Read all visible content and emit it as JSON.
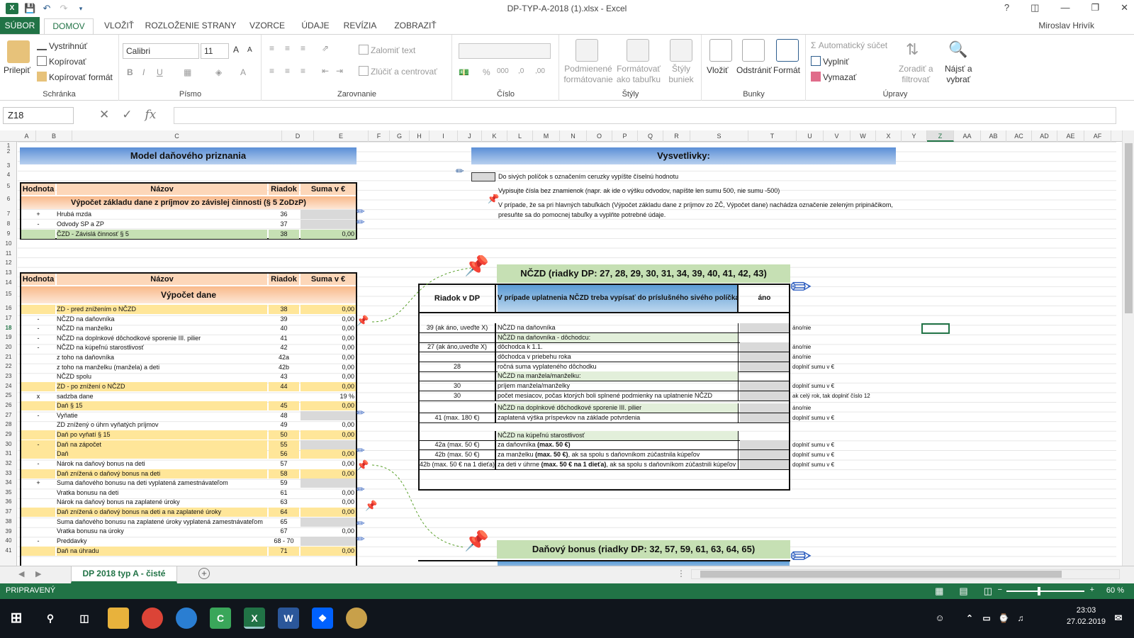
{
  "window": {
    "title": "DP-TYP-A-2018 (1).xlsx - Excel",
    "help": "?",
    "minimize": "—",
    "restore": "❐",
    "close": "✕"
  },
  "menu": {
    "file": "SÚBOR",
    "tabs": [
      "DOMOV",
      "VLOŽIŤ",
      "ROZLOŽENIE STRANY",
      "VZORCE",
      "ÚDAJE",
      "REVÍZIA",
      "ZOBRAZIŤ"
    ],
    "user": "Miroslav Hrivík"
  },
  "ribbon": {
    "clipboard": {
      "paste": "Prilepiť",
      "cut": "Vystrihnúť",
      "copy": "Kopírovať",
      "format_painter": "Kopírovať formát",
      "label": "Schránka"
    },
    "font": {
      "name": "Calibri",
      "size": "11",
      "label": "Písmo"
    },
    "alignment": {
      "wrap": "Zalomiť text",
      "merge": "Zlúčiť a centrovať",
      "label": "Zarovnanie"
    },
    "number": {
      "format": "",
      "label": "Číslo"
    },
    "styles": {
      "conditional_1": "Podmienené",
      "conditional_2": "formátovanie",
      "table_1": "Formátovať",
      "table_2": "ako tabuľku",
      "cell_1": "Štýly",
      "cell_2": "buniek",
      "label": "Štýly"
    },
    "cells": {
      "insert": "Vložiť",
      "delete": "Odstrániť",
      "format": "Formát",
      "label": "Bunky"
    },
    "editing": {
      "autosum": "Automatický súčet",
      "fill": "Vyplniť",
      "clear": "Vymazať",
      "sort_1": "Zoradiť a",
      "sort_2": "filtrovať",
      "find_1": "Nájsť a",
      "find_2": "vybrať",
      "label": "Úpravy"
    }
  },
  "formula_bar": {
    "name_box": "Z18",
    "fx": "fx",
    "formula": ""
  },
  "columns": [
    "A",
    "B",
    "C",
    "D",
    "E",
    "F",
    "G",
    "H",
    "I",
    "J",
    "K",
    "L",
    "M",
    "N",
    "O",
    "P",
    "Q",
    "R",
    "S",
    "T",
    "U",
    "V",
    "W",
    "X",
    "Y",
    "Z",
    "AA",
    "AB",
    "AC",
    "AD",
    "AE",
    "AF"
  ],
  "rows": [
    "1",
    "2",
    "3",
    "4",
    "5",
    "6",
    "7",
    "8",
    "9",
    "10",
    "11",
    "12",
    "13",
    "14",
    "15",
    "16",
    "17",
    "18",
    "19",
    "20",
    "21",
    "22",
    "23",
    "24",
    "25",
    "26",
    "27",
    "28",
    "29",
    "30",
    "31",
    "32",
    "33",
    "34",
    "35",
    "36",
    "37",
    "38",
    "39",
    "40",
    "41"
  ],
  "sheet": {
    "model_title": "Model daňového priznania",
    "table1": {
      "headers": [
        "Hodnota",
        "Názov",
        "Riadok",
        "Suma v €"
      ],
      "section": "Výpočet základu dane z príjmov zo závislej činnosti (§ 5 ZoDzP)",
      "rows": [
        {
          "op": "+",
          "name": "Hrubá mzda",
          "line": "36",
          "sum": ""
        },
        {
          "op": "-",
          "name": "Odvody SP a ZP",
          "line": "37",
          "sum": ""
        },
        {
          "op": "",
          "name": "ČZD - Závislá činnosť § 5",
          "line": "38",
          "sum": "0,00"
        }
      ]
    },
    "table2": {
      "headers": [
        "Hodnota",
        "Názov",
        "Riadok",
        "Suma v €"
      ],
      "section": "Výpočet dane",
      "rows": [
        {
          "op": "",
          "name": "ZD - pred znížením o NČZD",
          "line": "38",
          "sum": "0,00"
        },
        {
          "op": "-",
          "name": "NČZD na daňovníka",
          "line": "39",
          "sum": "0,00"
        },
        {
          "op": "-",
          "name": "NČZD na manželku",
          "line": "40",
          "sum": "0,00"
        },
        {
          "op": "-",
          "name": "NČZD na doplnkové dôchodkové sporenie III. pilier",
          "line": "41",
          "sum": "0,00"
        },
        {
          "op": "-",
          "name": "NČZD na kúpeľnú starostlivosť",
          "line": "42",
          "sum": "0,00"
        },
        {
          "op": "",
          "name": "z toho na daňovníka",
          "line": "42a",
          "sum": "0,00"
        },
        {
          "op": "",
          "name": "z toho na manželku (manžela) a deti",
          "line": "42b",
          "sum": "0,00"
        },
        {
          "op": "",
          "name": "NČZD spolu",
          "line": "43",
          "sum": "0,00"
        },
        {
          "op": "",
          "name": "ZD - po znížení o NČZD",
          "line": "44",
          "sum": "0,00"
        },
        {
          "op": "x",
          "name": "sadzba dane",
          "line": "",
          "sum": "19 %"
        },
        {
          "op": "",
          "name": "Daň § 15",
          "line": "45",
          "sum": "0,00"
        },
        {
          "op": "-",
          "name": "Vyňatie",
          "line": "48",
          "sum": ""
        },
        {
          "op": "",
          "name": "ZD znížený o úhrn vyňatých príjmov",
          "line": "49",
          "sum": "0,00"
        },
        {
          "op": "",
          "name": "Daň po vyňatí § 15",
          "line": "50",
          "sum": "0,00"
        },
        {
          "op": "-",
          "name": "Daň na zápočet",
          "line": "55",
          "sum": ""
        },
        {
          "op": "",
          "name": "Daň",
          "line": "56",
          "sum": "0,00"
        },
        {
          "op": "-",
          "name": "Nárok na daňový bonus na deti",
          "line": "57",
          "sum": "0,00"
        },
        {
          "op": "",
          "name": "Daň znížená o daňový bonus na deti",
          "line": "58",
          "sum": "0,00"
        },
        {
          "op": "+",
          "name": "Suma daňového bonusu na deti vyplatená zamestnávateľom",
          "line": "59",
          "sum": ""
        },
        {
          "op": "",
          "name": "Vratka bonusu na deti",
          "line": "61",
          "sum": "0,00"
        },
        {
          "op": "",
          "name": "Nárok na daňový bonus na zaplatené úroky",
          "line": "63",
          "sum": "0,00"
        },
        {
          "op": "",
          "name": "Daň znížená o daňový bonus na deti a na zaplatené úroky",
          "line": "64",
          "sum": "0,00"
        },
        {
          "op": "",
          "name": "Suma daňového bonusu na zaplatené úroky vyplatená zamestnávateľom",
          "line": "65",
          "sum": ""
        },
        {
          "op": "",
          "name": "Vratka bonusu na úroky",
          "line": "67",
          "sum": "0,00"
        },
        {
          "op": "-",
          "name": "Preddavky",
          "line": "68 - 70",
          "sum": ""
        },
        {
          "op": "",
          "name": "Daň na úhradu",
          "line": "71",
          "sum": "0,00"
        }
      ]
    },
    "explain": {
      "title": "Vysvetlivky:",
      "line1": "Do sivých políčok s označením ceruzky vypíšte číselnú hodnotu",
      "line2": "Vypisujte čísla bez znamienok (napr. ak ide o výšku odvodov, napíšte len sumu 500, nie sumu -500)",
      "line3": "V prípade, že sa pri hlavných tabuľkách (Výpočet základu dane z príjmov zo ZČ, Výpočet dane) nachádza označenie zeleným pripináčikom,",
      "line4": "presuňte sa do pomocnej tabuľky a vyplňte potrebné údaje."
    },
    "nczd": {
      "title": "NČZD (riadky DP: 27, 28, 29, 30, 31, 34, 39, 40, 41, 42, 43)",
      "col_line": "Riadok v DP",
      "col_desc": "V prípade uplatnenia NČZD treba vypísať do príslušného sivého políčka:",
      "col_yes": "áno",
      "rows": [
        {
          "line": "39 (ak áno, uveďte X)",
          "desc": "NČZD na daňovníka",
          "hint": "áno/nie"
        },
        {
          "line": "",
          "desc": "NČZD na daňovníka - dôchodcu:",
          "hint": ""
        },
        {
          "line": "27 (ak áno,uveďte X)",
          "desc": "dôchodca k 1.1.",
          "hint": "áno/nie"
        },
        {
          "line": "",
          "desc": "dôchodca v priebehu roka",
          "hint": "áno/nie"
        },
        {
          "line": "28",
          "desc": "ročná suma vyplateného dôchodku",
          "hint": "doplniť sumu v €"
        },
        {
          "line": "",
          "desc": "NČZD na manžela/manželku:",
          "hint": ""
        },
        {
          "line": "30",
          "desc": "príjem manžela/manželky",
          "hint": "doplniť sumu v €"
        },
        {
          "line": "30",
          "desc": "počet mesiacov, počas ktorých boli splnené podmienky na uplatnenie NČZD",
          "hint": "ak celý rok, tak doplniť číslo 12"
        },
        {
          "line": "",
          "desc": "NČZD na doplnkové dôchodkové sporenie III. pilier",
          "hint": "áno/nie"
        },
        {
          "line": "41 (max. 180 €)",
          "desc": "zaplatená výška príspevkov na základe potvrdenia",
          "hint": "doplniť sumu v €"
        },
        {
          "line": "",
          "desc": "NČZD na kúpeľnú starostlivosť",
          "hint": ""
        },
        {
          "line": "42a (max. 50 €)",
          "desc": "za daňovníka (max. 50 €)",
          "hint": "doplniť sumu v €"
        },
        {
          "line": "42b (max. 50 €)",
          "desc": "za manželku (max. 50 €), ak sa spolu s daňovníkom zúčastnila kúpeľov",
          "hint": "doplniť sumu v €"
        },
        {
          "line": "42b (max. 50 € na 1 dieťa)",
          "desc": "za deti v úhrne (max. 50 € na 1 dieťa), ak sa spolu s daňovníkom zúčastnili kúpeľov",
          "hint": "doplniť sumu v €"
        }
      ]
    },
    "bonus": {
      "title": "Daňový bonus (riadky DP: 32, 57, 59, 61, 63, 64, 65)"
    }
  },
  "sheet_tab": "DP 2018 typ A - čisté",
  "status": {
    "state": "PRIPRAVENÝ",
    "zoom": "60 %"
  },
  "taskbar": {
    "time": "23:03",
    "date": "27.02.2019"
  },
  "colors": {
    "excel_green": "#217346",
    "header_blue": "#5b8fd6",
    "orange": "#fdd7b9",
    "yellow": "#ffe699",
    "green": "#c6e0b4",
    "grey": "#d9d9d9"
  }
}
